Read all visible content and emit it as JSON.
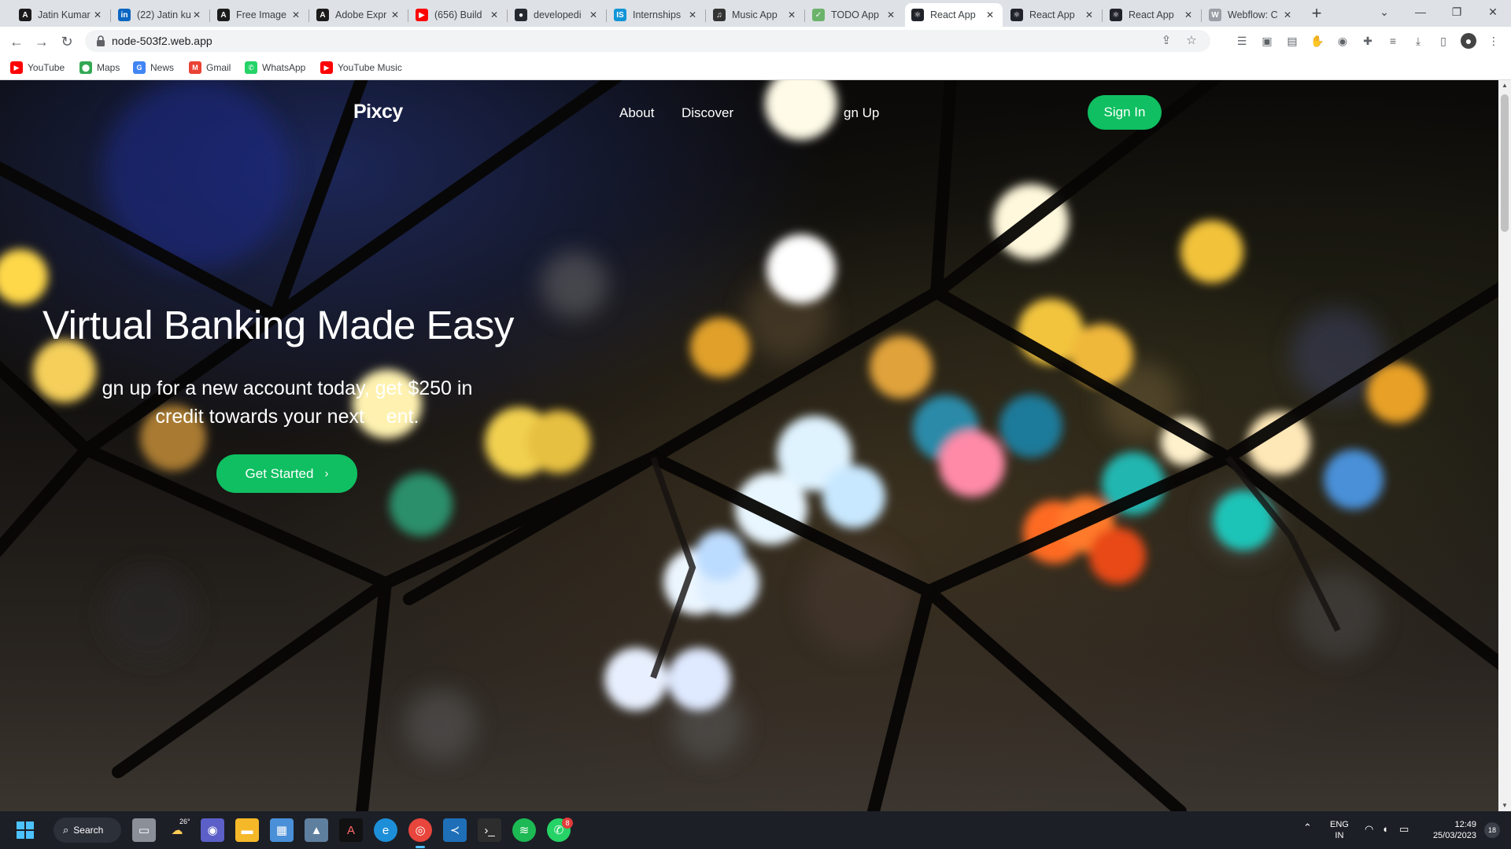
{
  "browser": {
    "tabs": [
      {
        "title": "Jatin Kumar",
        "icon": "author-icon",
        "color": "#1b1b1b",
        "glyph": "A"
      },
      {
        "title": "(22) Jatin ku",
        "icon": "linkedin-icon",
        "color": "#0a66c2",
        "glyph": "in"
      },
      {
        "title": "Free Image",
        "icon": "adobe-express-icon",
        "color": "#1b1b1b",
        "glyph": "A"
      },
      {
        "title": "Adobe Expr",
        "icon": "adobe-express-icon",
        "color": "#1b1b1b",
        "glyph": "A"
      },
      {
        "title": "(656) Build",
        "icon": "youtube-icon",
        "color": "#ff0000",
        "glyph": "▶"
      },
      {
        "title": "developedi",
        "icon": "github-icon",
        "color": "#24292f",
        "glyph": "●"
      },
      {
        "title": "Internships",
        "icon": "internshala-icon",
        "color": "#1295d8",
        "glyph": "IS"
      },
      {
        "title": "Music App",
        "icon": "headphones-icon",
        "color": "#333333",
        "glyph": "♫"
      },
      {
        "title": "TODO App",
        "icon": "todo-icon",
        "color": "#6bb36b",
        "glyph": "✓"
      },
      {
        "title": "React App",
        "icon": "react-icon",
        "color": "#20232a",
        "glyph": "⚛"
      },
      {
        "title": "React App",
        "icon": "react-icon",
        "color": "#20232a",
        "glyph": "⚛"
      },
      {
        "title": "React App",
        "icon": "react-icon",
        "color": "#20232a",
        "glyph": "⚛"
      },
      {
        "title": "Webflow: C",
        "icon": "webflow-icon",
        "color": "#9aa0a6",
        "glyph": "W"
      }
    ],
    "url": "node-503f2.web.app",
    "bookmarks": [
      {
        "label": "YouTube",
        "icon": "youtube-icon",
        "color": "#ff0000",
        "glyph": "▶"
      },
      {
        "label": "Maps",
        "icon": "maps-icon",
        "color": "#34a853",
        "glyph": "⬤"
      },
      {
        "label": "News",
        "icon": "news-icon",
        "color": "#4285f4",
        "glyph": "G"
      },
      {
        "label": "Gmail",
        "icon": "gmail-icon",
        "color": "#ea4335",
        "glyph": "M"
      },
      {
        "label": "WhatsApp",
        "icon": "whatsapp-icon",
        "color": "#25d366",
        "glyph": "✆"
      },
      {
        "label": "YouTube Music",
        "icon": "youtube-music-icon",
        "color": "#ff0000",
        "glyph": "▶"
      }
    ]
  },
  "site": {
    "logo": "Pixcy",
    "nav": {
      "about": "About",
      "discover": "Discover",
      "signup": "gn Up",
      "signin": "Sign In"
    },
    "hero": {
      "title": "Virtual Banking Made Easy",
      "subtitle_line1": "gn up for a new account today, get $250 in",
      "subtitle_line2": "credit towards your next    ent.",
      "cta": "Get Started"
    },
    "accent_color": "#0fbf61"
  },
  "taskbar": {
    "search_label": "Search",
    "weather": "26°",
    "whatsapp_badge": "8",
    "lang_line1": "ENG",
    "lang_line2": "IN",
    "time": "12:49",
    "date": "25/03/2023",
    "notification_count": "18"
  }
}
